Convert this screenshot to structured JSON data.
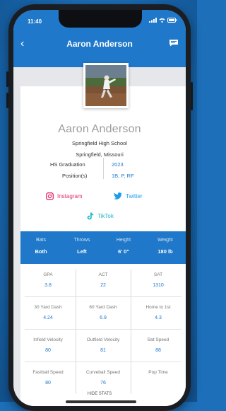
{
  "statusbar": {
    "time": "11:40"
  },
  "header": {
    "title": "Aaron Anderson"
  },
  "profile": {
    "name": "Aaron Anderson",
    "school": "Springfield High School",
    "location": "Springfield, Missouri",
    "graduation_label": "HS Graduation",
    "graduation_value": "2023",
    "positions_label": "Position(s)",
    "positions_value": "1B, P, RF"
  },
  "social": {
    "instagram": "Instagram",
    "twitter": "Twitter",
    "tiktok": "TikTok"
  },
  "statband": [
    {
      "label": "Bats",
      "value": "Both"
    },
    {
      "label": "Throws",
      "value": "Left"
    },
    {
      "label": "Height",
      "value": "6' 0\""
    },
    {
      "label": "Weight",
      "value": "180 lb"
    }
  ],
  "stats": [
    {
      "label": "GPA",
      "value": "3.8"
    },
    {
      "label": "ACT",
      "value": "22"
    },
    {
      "label": "SAT",
      "value": "1310"
    },
    {
      "label": "30 Yard Dash",
      "value": "4.24"
    },
    {
      "label": "60 Yard Dash",
      "value": "6.9"
    },
    {
      "label": "Home to 1st",
      "value": "4.3"
    },
    {
      "label": "Infield Velocity",
      "value": "80"
    },
    {
      "label": "Outfield Velocity",
      "value": "81"
    },
    {
      "label": "Bat Speed",
      "value": "88"
    },
    {
      "label": "Fastball Speed",
      "value": "80"
    },
    {
      "label": "Curveball Speed",
      "value": "76"
    },
    {
      "label": "Pop Time",
      "value": ""
    }
  ],
  "footer": {
    "text": "HIDE STATS"
  },
  "colors": {
    "primary": "#1f78c9",
    "instagram": "#e1306c",
    "twitter": "#1d9bf0",
    "tiktok": "#1fb8c8"
  }
}
